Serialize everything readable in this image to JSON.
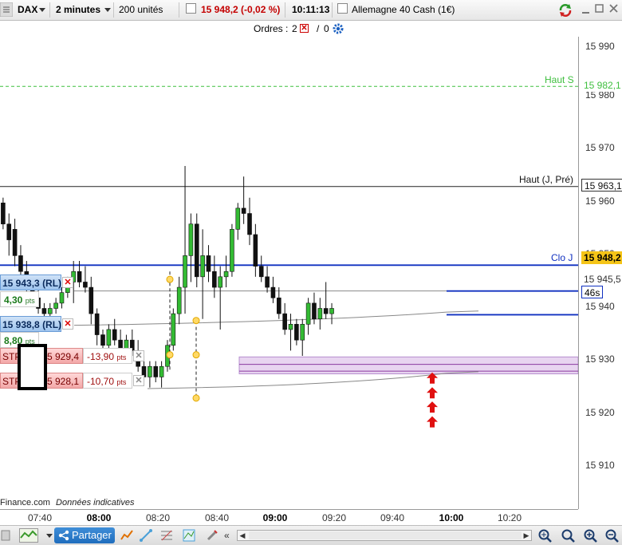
{
  "toolbar": {
    "instrument": "DAX",
    "timeframe": "2 minutes",
    "units": "200 unités",
    "price_change": "15 948,2 (-0,02 %)",
    "time": "10:11:13",
    "market_name": "Allemagne 40 Cash (1€)"
  },
  "orders_bar": {
    "label": "Ordres :",
    "count_a": "2",
    "separator": "/",
    "count_b": "0"
  },
  "y_axis_ticks": [
    "15 990",
    "15 980",
    "15 970",
    "15 960",
    "15 950",
    "15 940",
    "15 930",
    "15 920",
    "15 910"
  ],
  "price_lines": {
    "haut_s": {
      "label": "Haut S",
      "value": "15 982,1"
    },
    "haut_j": {
      "label": "Haut (J, Pré)",
      "value": "15 963,1"
    },
    "clo_j": {
      "label": "Clo J",
      "value": "15 948,2"
    },
    "line_945": {
      "value": "15 945,5"
    },
    "countdown": "46s"
  },
  "order_tags": [
    {
      "price": "15 943,3",
      "type": "(RL)",
      "pts_value": "4,30",
      "pts_unit": "pts"
    },
    {
      "price": "15 938,8",
      "type": "(RL)",
      "pts_value": "8,80",
      "pts_unit": "pts"
    },
    {
      "prefix": "STP",
      "price": "5 929,4",
      "pts": "-13,90",
      "pts_unit": "pts"
    },
    {
      "prefix": "STP",
      "price": "5 928,1",
      "pts": "-10,70",
      "pts_unit": "pts"
    }
  ],
  "time_axis": [
    {
      "label": "07:40",
      "strong": false
    },
    {
      "label": "08:00",
      "strong": true
    },
    {
      "label": "08:20",
      "strong": false
    },
    {
      "label": "08:40",
      "strong": false
    },
    {
      "label": "09:00",
      "strong": true
    },
    {
      "label": "09:20",
      "strong": false
    },
    {
      "label": "09:40",
      "strong": false
    },
    {
      "label": "10:00",
      "strong": true
    },
    {
      "label": "10:20",
      "strong": false
    }
  ],
  "credits": {
    "source": "Finance.com",
    "note": "Données indicatives"
  },
  "bottom_bar": {
    "share_label": "Partager"
  },
  "colors": {
    "bull": "#33bb33",
    "bear": "#111111",
    "clo_line": "#1030c0",
    "haut_s": "#3fbf3f",
    "zone": "#e8d5f0",
    "arrow": "#e01010"
  },
  "chart_data": {
    "type": "candlestick",
    "timeframe_minutes": 2,
    "ylim": [
      15905,
      15994
    ],
    "candles": [
      {
        "t": "07:26",
        "o": 15960,
        "h": 15961,
        "l": 15955,
        "c": 15956
      },
      {
        "t": "07:28",
        "o": 15956,
        "h": 15958,
        "l": 15950,
        "c": 15953
      },
      {
        "t": "07:30",
        "o": 15955,
        "h": 15957,
        "l": 15948,
        "c": 15950
      },
      {
        "t": "07:32",
        "o": 15950,
        "h": 15952,
        "l": 15946,
        "c": 15947
      },
      {
        "t": "07:34",
        "o": 15947,
        "h": 15949,
        "l": 15942,
        "c": 15944
      },
      {
        "t": "07:36",
        "o": 15944,
        "h": 15946,
        "l": 15941,
        "c": 15942
      },
      {
        "t": "07:38",
        "o": 15942,
        "h": 15944,
        "l": 15939,
        "c": 15940
      },
      {
        "t": "07:40",
        "o": 15940,
        "h": 15941,
        "l": 15938,
        "c": 15939
      },
      {
        "t": "07:42",
        "o": 15939,
        "h": 15941,
        "l": 15938,
        "c": 15940
      },
      {
        "t": "07:44",
        "o": 15940,
        "h": 15942,
        "l": 15939,
        "c": 15941
      },
      {
        "t": "07:46",
        "o": 15941,
        "h": 15944,
        "l": 15940,
        "c": 15943
      },
      {
        "t": "07:48",
        "o": 15943,
        "h": 15946,
        "l": 15942,
        "c": 15945
      },
      {
        "t": "07:50",
        "o": 15945,
        "h": 15949,
        "l": 15941,
        "c": 15947
      },
      {
        "t": "07:52",
        "o": 15947,
        "h": 15949,
        "l": 15944,
        "c": 15945
      },
      {
        "t": "07:54",
        "o": 15945,
        "h": 15948,
        "l": 15943,
        "c": 15944
      },
      {
        "t": "07:56",
        "o": 15944,
        "h": 15946,
        "l": 15937,
        "c": 15939
      },
      {
        "t": "07:58",
        "o": 15939,
        "h": 15940,
        "l": 15933,
        "c": 15935
      },
      {
        "t": "08:00",
        "o": 15935,
        "h": 15936,
        "l": 15931,
        "c": 15933
      },
      {
        "t": "08:02",
        "o": 15933,
        "h": 15937,
        "l": 15932,
        "c": 15936
      },
      {
        "t": "08:04",
        "o": 15936,
        "h": 15938,
        "l": 15933,
        "c": 15934
      },
      {
        "t": "08:06",
        "o": 15934,
        "h": 15936,
        "l": 15931,
        "c": 15932
      },
      {
        "t": "08:08",
        "o": 15932,
        "h": 15935,
        "l": 15930,
        "c": 15934
      },
      {
        "t": "08:10",
        "o": 15934,
        "h": 15936,
        "l": 15931,
        "c": 15932
      },
      {
        "t": "08:12",
        "o": 15932,
        "h": 15934,
        "l": 15928,
        "c": 15929
      },
      {
        "t": "08:14",
        "o": 15929,
        "h": 15931,
        "l": 15926,
        "c": 15927
      },
      {
        "t": "08:16",
        "o": 15927,
        "h": 15930,
        "l": 15925,
        "c": 15929
      },
      {
        "t": "08:18",
        "o": 15929,
        "h": 15930,
        "l": 15926,
        "c": 15927
      },
      {
        "t": "08:20",
        "o": 15927,
        "h": 15930,
        "l": 15925,
        "c": 15929
      },
      {
        "t": "08:22",
        "o": 15929,
        "h": 15934,
        "l": 15928,
        "c": 15933
      },
      {
        "t": "08:24",
        "o": 15933,
        "h": 15940,
        "l": 15932,
        "c": 15939
      },
      {
        "t": "08:26",
        "o": 15939,
        "h": 15946,
        "l": 15937,
        "c": 15944
      },
      {
        "t": "08:28",
        "o": 15944,
        "h": 15967,
        "l": 15939,
        "c": 15950
      },
      {
        "t": "08:30",
        "o": 15950,
        "h": 15958,
        "l": 15945,
        "c": 15956
      },
      {
        "t": "08:32",
        "o": 15956,
        "h": 15958,
        "l": 15944,
        "c": 15946
      },
      {
        "t": "08:34",
        "o": 15946,
        "h": 15955,
        "l": 15938,
        "c": 15950
      },
      {
        "t": "08:36",
        "o": 15950,
        "h": 15952,
        "l": 15945,
        "c": 15947
      },
      {
        "t": "08:38",
        "o": 15947,
        "h": 15950,
        "l": 15942,
        "c": 15944
      },
      {
        "t": "08:40",
        "o": 15944,
        "h": 15948,
        "l": 15936,
        "c": 15946
      },
      {
        "t": "08:42",
        "o": 15946,
        "h": 15950,
        "l": 15944,
        "c": 15947
      },
      {
        "t": "08:44",
        "o": 15947,
        "h": 15956,
        "l": 15946,
        "c": 15955
      },
      {
        "t": "08:46",
        "o": 15955,
        "h": 15960,
        "l": 15953,
        "c": 15959
      },
      {
        "t": "08:48",
        "o": 15959,
        "h": 15965,
        "l": 15956,
        "c": 15958
      },
      {
        "t": "08:50",
        "o": 15958,
        "h": 15961,
        "l": 15952,
        "c": 15954
      },
      {
        "t": "08:52",
        "o": 15954,
        "h": 15956,
        "l": 15946,
        "c": 15948
      },
      {
        "t": "08:54",
        "o": 15948,
        "h": 15950,
        "l": 15945,
        "c": 15946
      },
      {
        "t": "08:56",
        "o": 15946,
        "h": 15948,
        "l": 15943,
        "c": 15944
      },
      {
        "t": "08:58",
        "o": 15944,
        "h": 15946,
        "l": 15941,
        "c": 15942
      },
      {
        "t": "09:00",
        "o": 15942,
        "h": 15944,
        "l": 15938,
        "c": 15939
      },
      {
        "t": "09:02",
        "o": 15939,
        "h": 15941,
        "l": 15935,
        "c": 15936
      },
      {
        "t": "09:04",
        "o": 15936,
        "h": 15939,
        "l": 15932,
        "c": 15937
      },
      {
        "t": "09:06",
        "o": 15937,
        "h": 15938,
        "l": 15933,
        "c": 15934
      },
      {
        "t": "09:08",
        "o": 15934,
        "h": 15938,
        "l": 15931,
        "c": 15937
      },
      {
        "t": "09:10",
        "o": 15937,
        "h": 15942,
        "l": 15935,
        "c": 15941
      },
      {
        "t": "09:12",
        "o": 15941,
        "h": 15943,
        "l": 15937,
        "c": 15938
      },
      {
        "t": "09:14",
        "o": 15938,
        "h": 15942,
        "l": 15936,
        "c": 15940
      },
      {
        "t": "09:16",
        "o": 15940,
        "h": 15945,
        "l": 15938,
        "c": 15939
      },
      {
        "t": "09:18",
        "o": 15939,
        "h": 15941,
        "l": 15937,
        "c": 15940
      }
    ]
  }
}
